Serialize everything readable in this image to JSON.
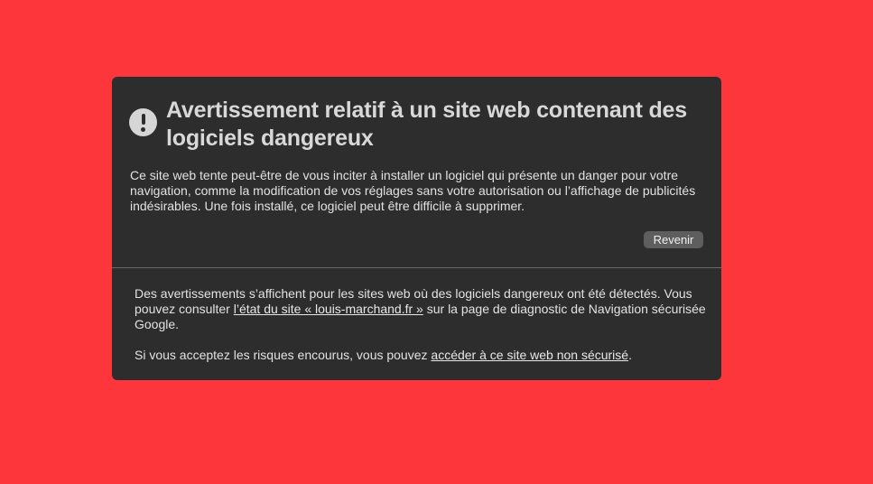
{
  "warning": {
    "icon": "exclamation-circle-icon",
    "title": "Avertissement relatif à un site web contenant des logiciels dangereux",
    "description": "Ce site web tente peut-être de vous inciter à installer un logiciel qui présente un danger pour votre navigation, comme la modification de vos réglages sans votre autorisation ou l’affichage de publicités indésirables. Une fois installé, ce logiciel peut être difficile à supprimer.",
    "back_label": "Revenir"
  },
  "details": {
    "line1_intro": "Des avertissements s’affichent pour les sites web où des logiciels dangereux ont été détectés. Vous pouvez consulter ",
    "status_link": "l’état du site « louis-marchand.fr »",
    "line1_outro": " sur la page de diagnostic de Navigation sécurisée Google.",
    "line2_intro": "Si vous acceptez les risques encourus, vous pouvez ",
    "proceed_link": "accéder à ce site web non sécurisé",
    "line2_outro": "."
  },
  "colors": {
    "background": "#fc363b",
    "panel": "#2d2d2d",
    "button": "#5e5e5e"
  }
}
